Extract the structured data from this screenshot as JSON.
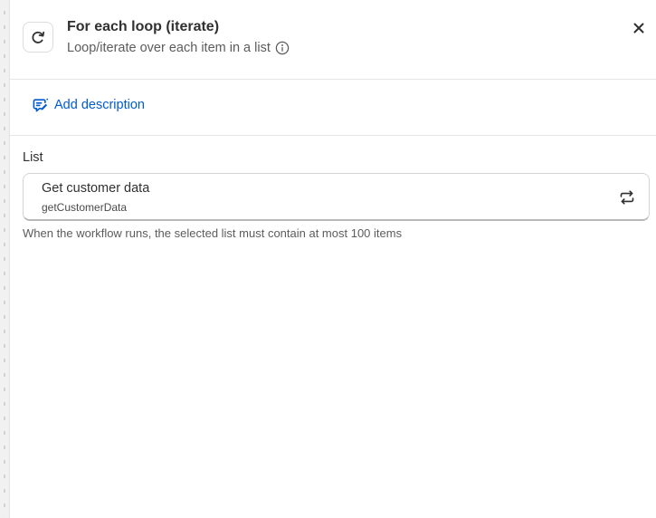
{
  "step": {
    "title": "For each loop (iterate)",
    "subtitle": "Loop/iterate over each item in a list",
    "icon": "refresh-loop-icon"
  },
  "close": {
    "icon": "close-icon",
    "glyph": "×"
  },
  "description": {
    "add_label": "Add description",
    "icon": "chat-edit-icon"
  },
  "list_field": {
    "label": "List",
    "selected_name": "Get customer data",
    "selected_id": "getCustomerData",
    "swap_icon": "swap-arrows-icon",
    "help_text": "When the workflow runs, the selected list must contain at most 100 items"
  },
  "colors": {
    "accent": "#005bd3",
    "text": "#303030",
    "muted": "#5c5c5c",
    "border": "#e6e6e6"
  }
}
